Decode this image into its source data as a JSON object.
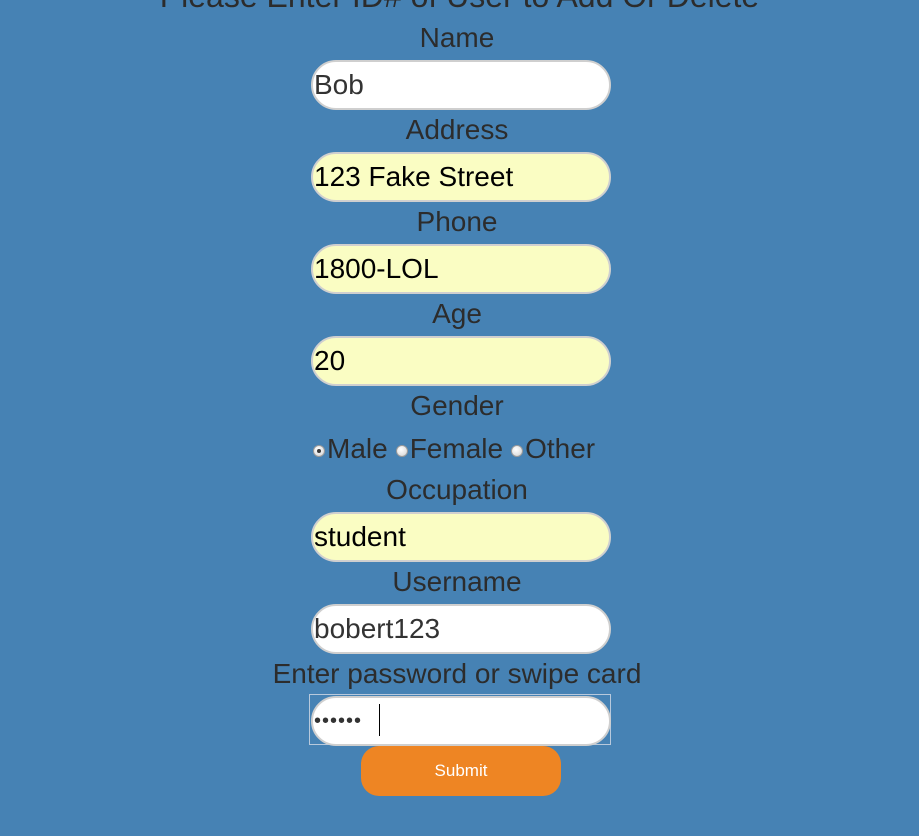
{
  "page": {
    "heading": "Please Enter ID# of User to Add Or Delete"
  },
  "form": {
    "name": {
      "label": "Name",
      "value": "Bob"
    },
    "address": {
      "label": "Address",
      "value": "123 Fake Street"
    },
    "phone": {
      "label": "Phone",
      "value": "1800-LOL"
    },
    "age": {
      "label": "Age",
      "value": "20"
    },
    "gender": {
      "label": "Gender",
      "options": [
        "Male",
        "Female",
        "Other"
      ],
      "selected": "Male"
    },
    "occupation": {
      "label": "Occupation",
      "value": "student"
    },
    "username": {
      "label": "Username",
      "value": "bobert123"
    },
    "password": {
      "label": "Enter password or swipe card",
      "masked_value": "••••••"
    },
    "submit_label": "Submit"
  },
  "colors": {
    "page_background": "#4682b4",
    "autofill_background": "#fafdc3",
    "submit_background": "#ee8523",
    "text": "#2c2c2c"
  }
}
